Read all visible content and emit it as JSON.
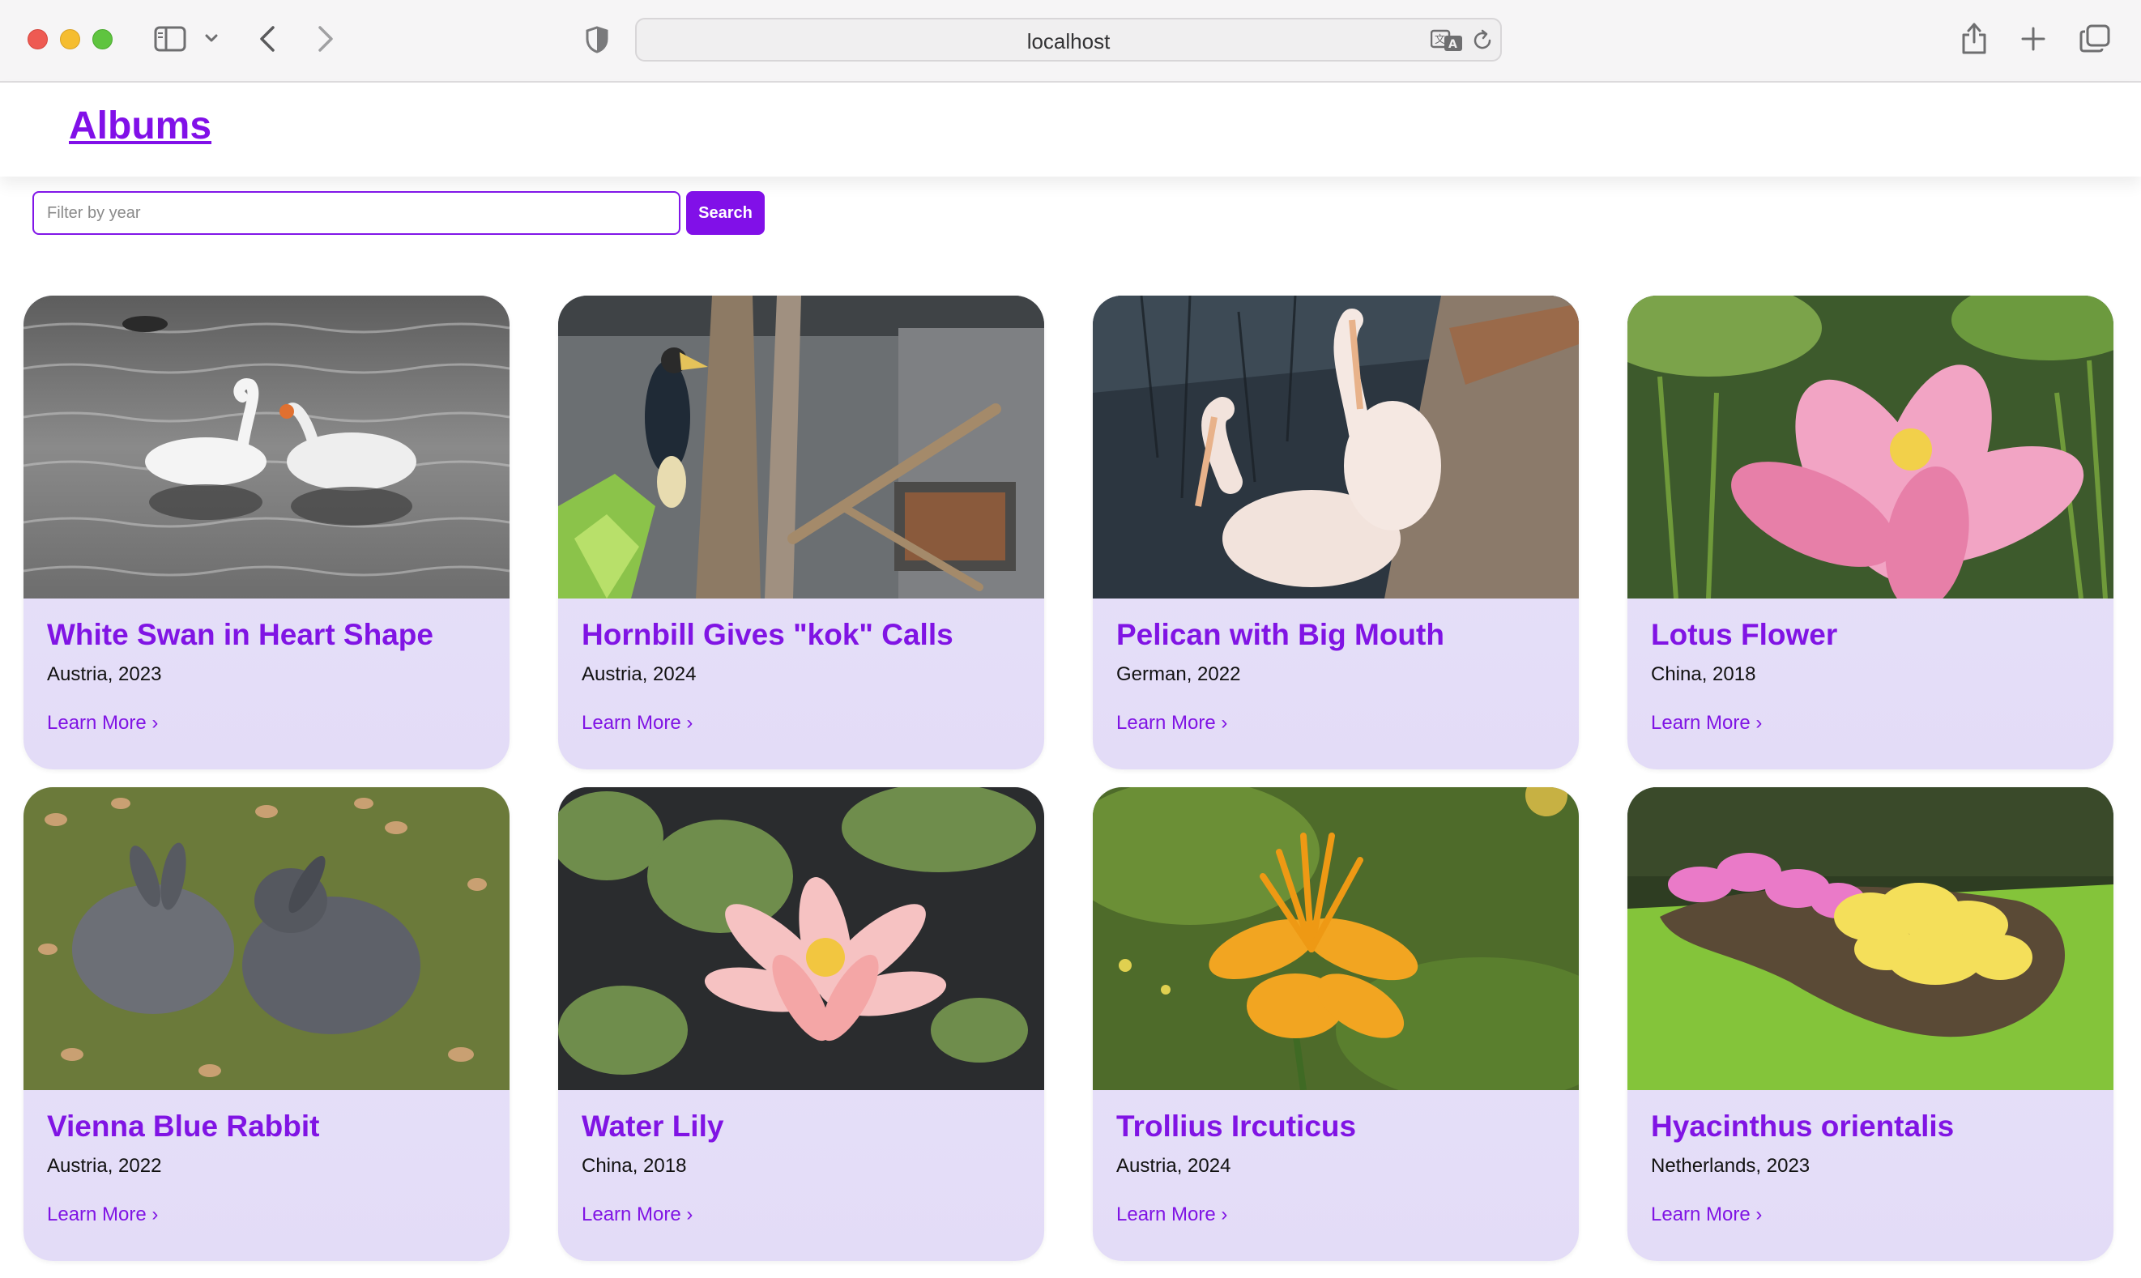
{
  "browser": {
    "url": "localhost"
  },
  "header": {
    "title": "Albums"
  },
  "search": {
    "placeholder": "Filter by year",
    "value": "",
    "button_label": "Search"
  },
  "albums": [
    {
      "title": "White Swan in Heart Shape",
      "meta": "Austria, 2023",
      "link": "Learn More ›",
      "image": "swan"
    },
    {
      "title": "Hornbill Gives \"kok\" Calls",
      "meta": "Austria, 2024",
      "link": "Learn More ›",
      "image": "hornbill"
    },
    {
      "title": "Pelican with Big Mouth",
      "meta": "German, 2022",
      "link": "Learn More ›",
      "image": "pelican"
    },
    {
      "title": "Lotus Flower",
      "meta": "China, 2018",
      "link": "Learn More ›",
      "image": "lotus"
    },
    {
      "title": "Vienna Blue Rabbit",
      "meta": "Austria, 2022",
      "link": "Learn More ›",
      "image": "rabbit"
    },
    {
      "title": "Water Lily",
      "meta": "China, 2018",
      "link": "Learn More ›",
      "image": "waterlily"
    },
    {
      "title": "Trollius Ircuticus",
      "meta": "Austria, 2024",
      "link": "Learn More ›",
      "image": "trollius"
    },
    {
      "title": "Hyacinthus orientalis",
      "meta": "Netherlands, 2023",
      "link": "Learn More ›",
      "image": "hyacinth"
    }
  ],
  "colors": {
    "accent": "#8110e8",
    "card_bg": "#e8e2fa",
    "traffic_red": "#ee5a52",
    "traffic_yellow": "#f5bd30",
    "traffic_green": "#5fc43f"
  },
  "icons": {
    "sidebar": "sidebar-icon",
    "back": "chevron-left-icon",
    "forward": "chevron-right-icon",
    "privacy": "shield-icon",
    "translate": "translate-icon",
    "reload": "reload-icon",
    "share": "share-icon",
    "new_tab": "plus-icon",
    "tab_overview": "tabs-icon"
  }
}
